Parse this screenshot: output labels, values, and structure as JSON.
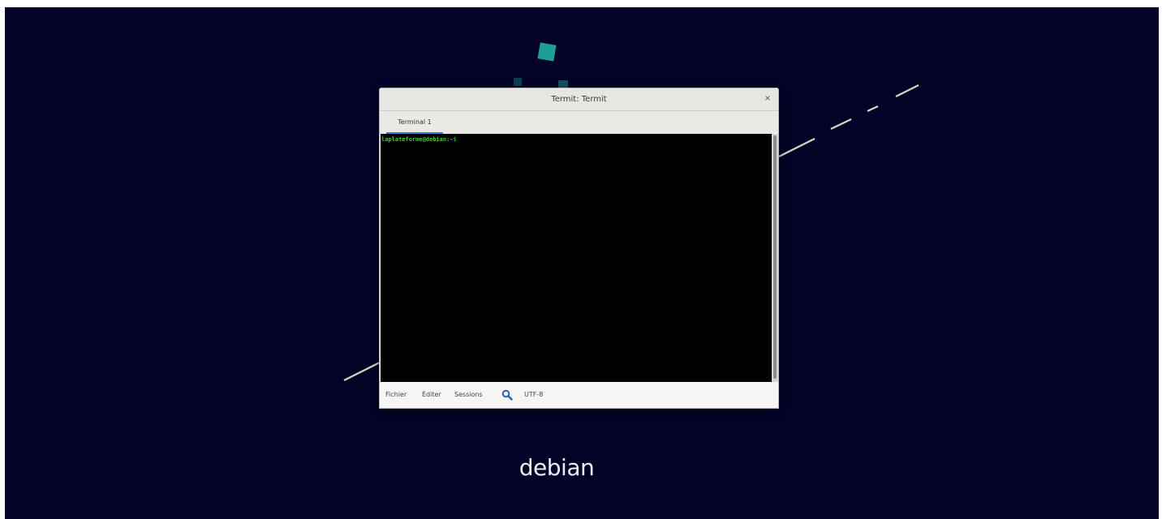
{
  "desktop": {
    "background_color": "#020327",
    "decoration_color": "#1e9e95",
    "logo_text": "debian"
  },
  "window": {
    "title": "Termit: Termit",
    "close_glyph": "×",
    "tabs": [
      {
        "label": "Terminal 1",
        "active": true
      }
    ],
    "terminal": {
      "prompt_user": "laplateforme@debian",
      "prompt_sep": ":",
      "prompt_path": "~",
      "prompt_char": "$"
    },
    "statusbar": {
      "menu_items": [
        "Fichier",
        "Éditer",
        "Sessions"
      ],
      "search_icon": "search-icon",
      "encoding": "UTF-8"
    }
  }
}
